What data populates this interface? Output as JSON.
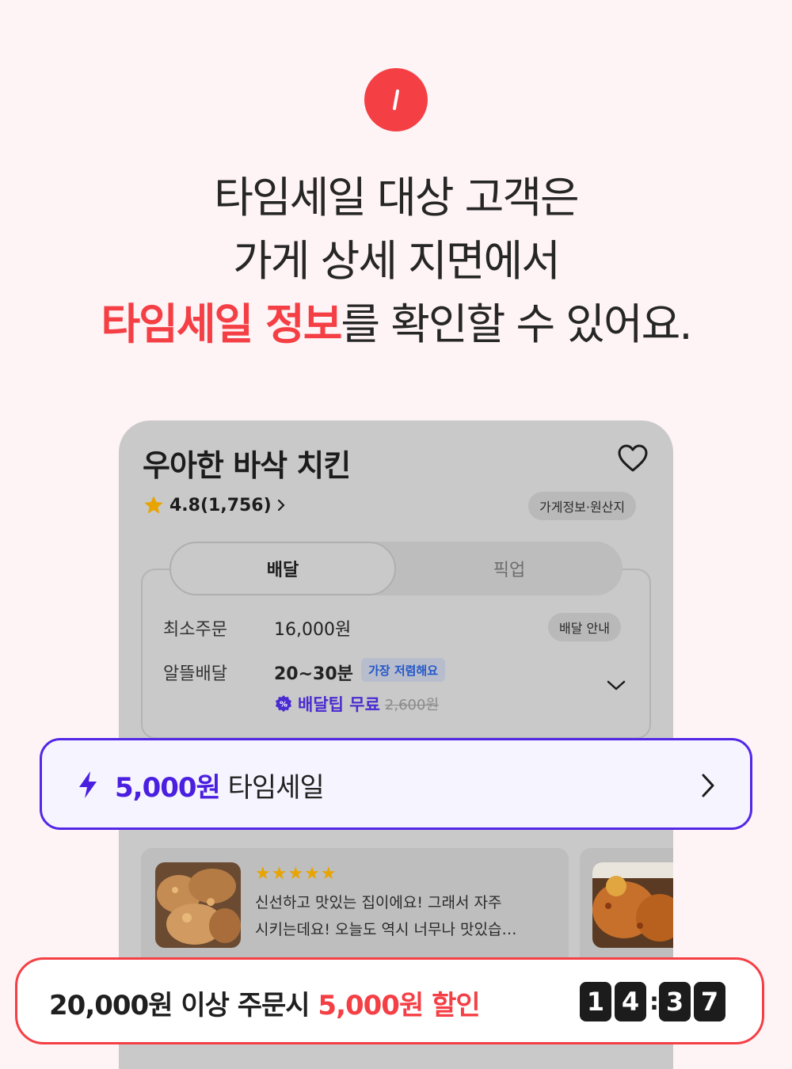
{
  "step": {
    "number": "1"
  },
  "headline": {
    "line1": "타임세일 대상 고객은",
    "line2": "가게 상세 지면에서",
    "line3_accent": "타임세일 정보",
    "line3_rest": "를 확인할 수 있어요."
  },
  "store": {
    "name": "우아한 바삭 치킨",
    "rating": "4.8(1,756)",
    "info_chip": "가게정보·원산지"
  },
  "tabs": {
    "delivery": "배달",
    "pickup": "픽업"
  },
  "order_info": {
    "min_order_label": "최소주문",
    "min_order_value": "16,000원",
    "delivery_guide": "배달 안내",
    "cheap_delivery_label": "알뜰배달",
    "delivery_time": "20~30분",
    "cheapest_badge": "가장 저렴해요",
    "free_tip_label": "배달팁 무료",
    "original_tip": "2,600원"
  },
  "review": {
    "stars": "★★★★★",
    "line1": "신선하고 맛있는 집이에요! 그래서 자주",
    "line2": "시키는데요! 오늘도 역시 너무나 맛있습…"
  },
  "timesale": {
    "amount": "5,000원",
    "label": "타임세일"
  },
  "discount": {
    "condition": "20,000원 이상 주문시",
    "highlight": "5,000원 할인",
    "timer": [
      "1",
      "4",
      "3",
      "7"
    ]
  },
  "colors": {
    "accent_red": "#F43F45",
    "accent_purple": "#4A1FE0",
    "background": "#FEF3F5"
  },
  "icons": [
    "heart-icon",
    "star-icon",
    "chevron-right-icon",
    "chevron-down-icon",
    "discount-icon",
    "bolt-icon"
  ]
}
